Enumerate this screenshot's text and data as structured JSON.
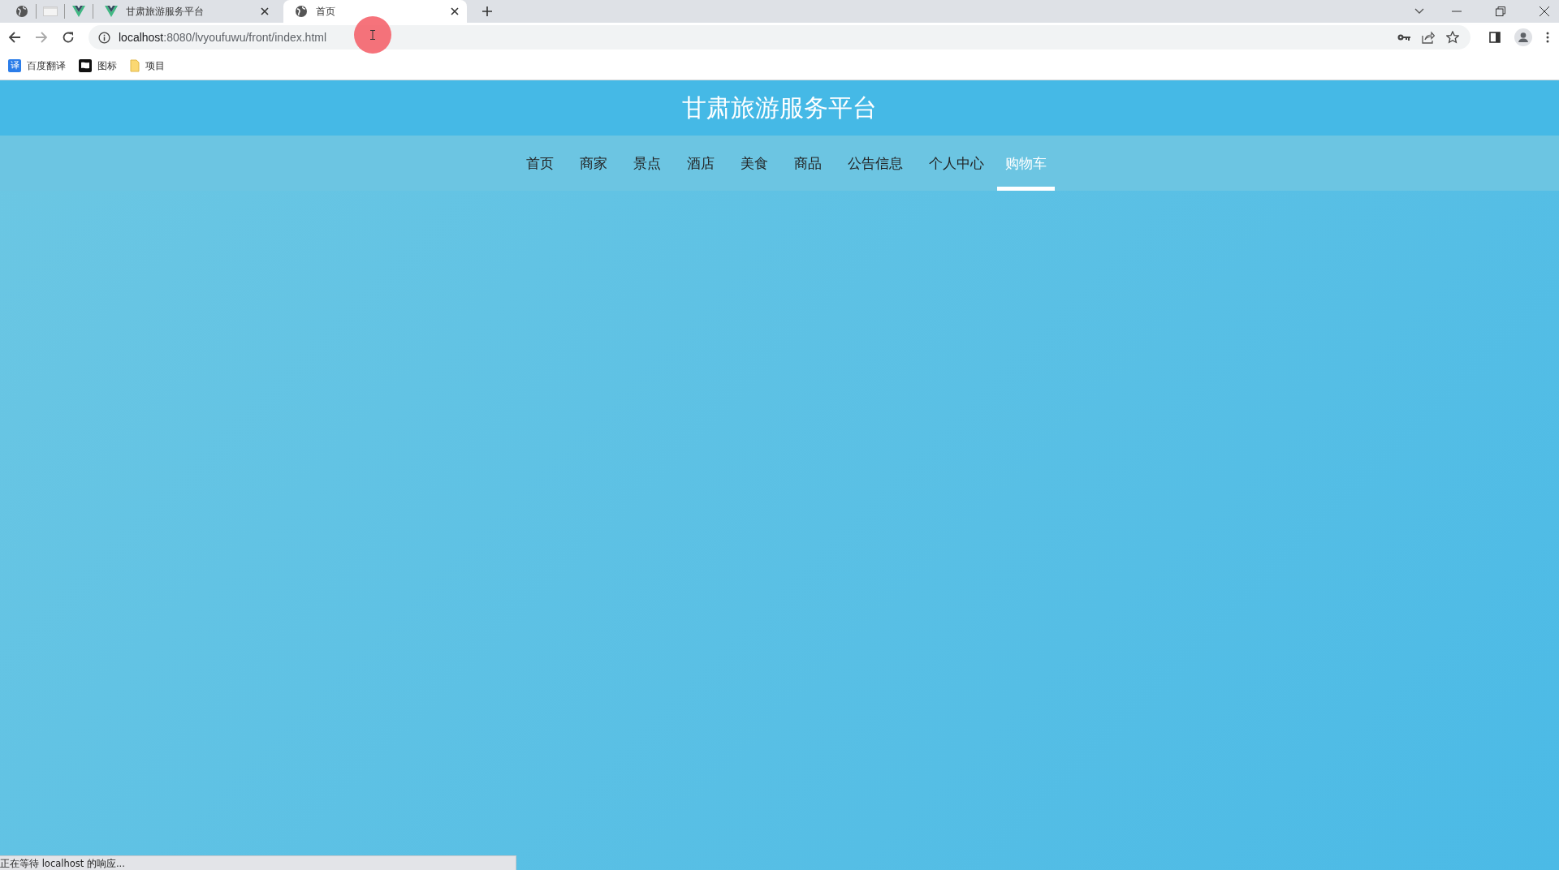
{
  "browser": {
    "pinned_tabs": [
      {
        "kind": "globe"
      },
      {
        "kind": "blank"
      },
      {
        "kind": "vue"
      }
    ],
    "tabs": [
      {
        "title": "甘肃旅游服务平台",
        "kind": "vue",
        "selected": false
      },
      {
        "title": "首页",
        "kind": "globe",
        "selected": true
      }
    ],
    "address": {
      "host": "localhost",
      "rest": ":8080/lvyoufuwu/front/index.html"
    },
    "bookmarks": [
      {
        "label": "百度翻译",
        "kind": "translate",
        "glyph": "译"
      },
      {
        "label": "图标",
        "kind": "flag"
      },
      {
        "label": "项目",
        "kind": "folder"
      }
    ]
  },
  "site": {
    "title": "甘肃旅游服务平台",
    "nav": [
      {
        "label": "首页",
        "selected": false
      },
      {
        "label": "商家",
        "selected": false
      },
      {
        "label": "景点",
        "selected": false
      },
      {
        "label": "酒店",
        "selected": false
      },
      {
        "label": "美食",
        "selected": false
      },
      {
        "label": "商品",
        "selected": false
      },
      {
        "label": "公告信息",
        "selected": false
      },
      {
        "label": "个人中心",
        "selected": false
      },
      {
        "label": "购物车",
        "selected": true
      }
    ]
  },
  "status_bar": "正在等待 localhost 的响应..."
}
